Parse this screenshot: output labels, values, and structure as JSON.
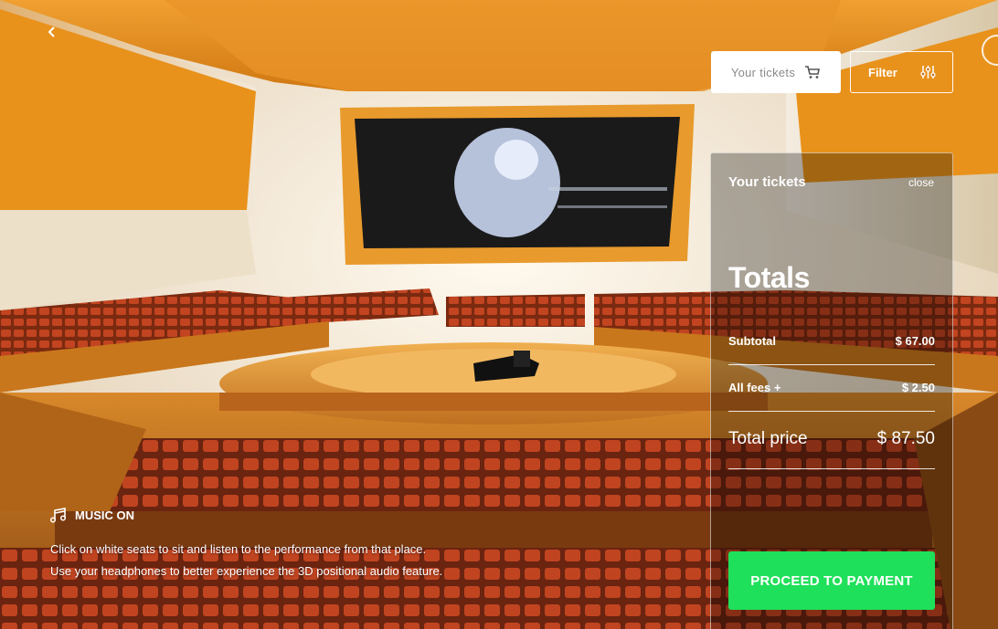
{
  "nav": {
    "back_icon": "chevron-left-icon"
  },
  "header": {
    "tickets_label": "Your tickets",
    "tickets_icon": "cart-icon",
    "filter_label": "Filter",
    "filter_icon": "sliders-icon"
  },
  "panel": {
    "title": "Your tickets",
    "close_label": "close",
    "totals_heading": "Totals",
    "subtotal_label": "Subtotal",
    "subtotal_value": "$ 67.00",
    "fees_label": "All fees +",
    "fees_value": "$ 2.50",
    "total_label": "Total price",
    "total_value": "$ 87.50",
    "pay_label": "PROCEED TO PAYMENT"
  },
  "audio": {
    "music_label": "MUSIC ON",
    "music_icon": "music-note-icon"
  },
  "info": {
    "line1": "Click on white seats to sit and listen to the performance from that place.",
    "line2": "Use your headphones to better experience the 3D positional audio feature."
  },
  "colors": {
    "accent_green": "#1fe05a",
    "wood": "#e8901e",
    "seat_red": "#b0381c"
  }
}
